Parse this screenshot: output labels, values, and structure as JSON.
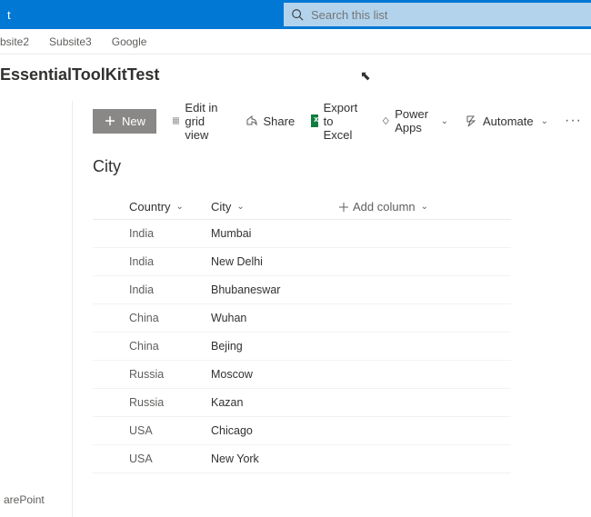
{
  "header": {
    "left_fragment": "t"
  },
  "search": {
    "placeholder": "Search this list"
  },
  "subnav": [
    "bsite2",
    "Subsite3",
    "Google"
  ],
  "site_title": "EssentialToolKitTest",
  "leftnav": {
    "bottom": "arePoint"
  },
  "cmdbar": {
    "new": "New",
    "edit_grid": "Edit in grid view",
    "share": "Share",
    "export": "Export to Excel",
    "powerapps": "Power Apps",
    "automate": "Automate"
  },
  "list_name": "City",
  "columns": {
    "country": "Country",
    "city": "City",
    "add": "Add column"
  },
  "rows": [
    {
      "country": "India",
      "city": "Mumbai"
    },
    {
      "country": "India",
      "city": "New Delhi"
    },
    {
      "country": "India",
      "city": "Bhubaneswar"
    },
    {
      "country": "China",
      "city": "Wuhan"
    },
    {
      "country": "China",
      "city": "Bejing"
    },
    {
      "country": "Russia",
      "city": "Moscow"
    },
    {
      "country": "Russia",
      "city": "Kazan"
    },
    {
      "country": "USA",
      "city": "Chicago"
    },
    {
      "country": "USA",
      "city": "New York"
    }
  ]
}
